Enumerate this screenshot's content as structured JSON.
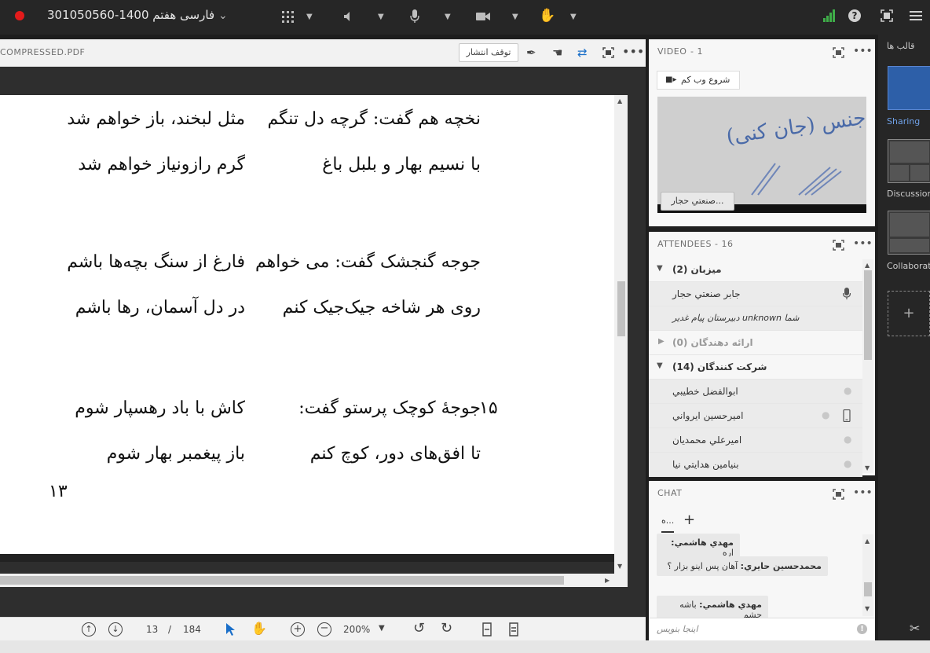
{
  "top_bar": {
    "meeting_title": "فارسی هفتم 1400-301050560",
    "title_chevron": "⌄",
    "icons": [
      "recording-dot",
      "apps-grid-icon",
      "speaker-icon",
      "microphone-icon",
      "camera-icon",
      "raise-hand-icon",
      "signal-bars-icon",
      "help-icon",
      "fullscreen-icon",
      "menu-icon"
    ]
  },
  "document_pod": {
    "filename": "COMPRESSED.PDF",
    "stop_sharing_label": "توقف انتشار",
    "poem_lines": [
      {
        "right": "نخچه هم گفت: گرچه دل تنگم",
        "left": "مثل لبخند، باز خواهم شد"
      },
      {
        "right": "با نسیم بهار و بلبل باغ",
        "left": "گرم رازونیاز خواهم شد"
      },
      {
        "right": "جوجه گنجشک گفت: می خواهم",
        "left": "فارغ از سنگ بچه‌ها باشم"
      },
      {
        "right": "روی هر شاخه جیک‌جیک کنم",
        "left": "در دل آسمان، رها باشم"
      },
      {
        "right": "جوجهٔ کوچک پرستو گفت:",
        "left": "کاش با باد رهسپار شوم"
      },
      {
        "right": "تا افق‌های دور، کوچ کنم",
        "left": "باز پیغمبر بهار شوم"
      }
    ],
    "verse_number": "۱۵",
    "page_number_print": "۱۳",
    "toolbar": {
      "current_page": "13",
      "separator": "/",
      "total_pages": "184",
      "zoom": "200%"
    }
  },
  "video_pod": {
    "title": "VIDEO",
    "count": "- 1",
    "start_webcam_label": "شروع وب کم",
    "presenter_name": "صنعتي حجار...",
    "board_text": "جنس (جان کنی)"
  },
  "attendees_pod": {
    "title": "ATTENDEES",
    "count": "- 16",
    "groups": [
      {
        "label": "میزبان (2)",
        "expanded": true,
        "members": [
          "جابر صنعتي حجار",
          "شما unknown دبیرستان پیام غدیر"
        ]
      },
      {
        "label": "ارائه دهندگان (0)",
        "expanded": false,
        "members": []
      },
      {
        "label": "شرکت کنندگان (14)",
        "expanded": true,
        "members": [
          "ابوالفضل خطيبي",
          "اميرحسين ايرواني",
          "اميرعلي محمديان",
          "بنيامين هدايتي نيا"
        ]
      }
    ]
  },
  "chat_pod": {
    "title": "CHAT",
    "tab_label": "ه...",
    "add_tab": "+",
    "messages": [
      {
        "sender": "مهدي هاشمي:",
        "text": "اره"
      },
      {
        "sender": "محمدحسين حايري:",
        "text": "آهان پس اينو بزار ؟"
      },
      {
        "sender": "مهدي هاشمي:",
        "text": "باشه چشم"
      }
    ],
    "input_placeholder": "اینجا بنویس"
  },
  "layouts": {
    "title": "قالب ها",
    "items": [
      "Sharing",
      "Discussion",
      "Collaboration"
    ],
    "add": "+"
  },
  "colors": {
    "accent_blue": "#2d5fa8",
    "record_red": "#e31b1b",
    "dark_bg": "#262626",
    "signal_green": "#3fae49"
  }
}
